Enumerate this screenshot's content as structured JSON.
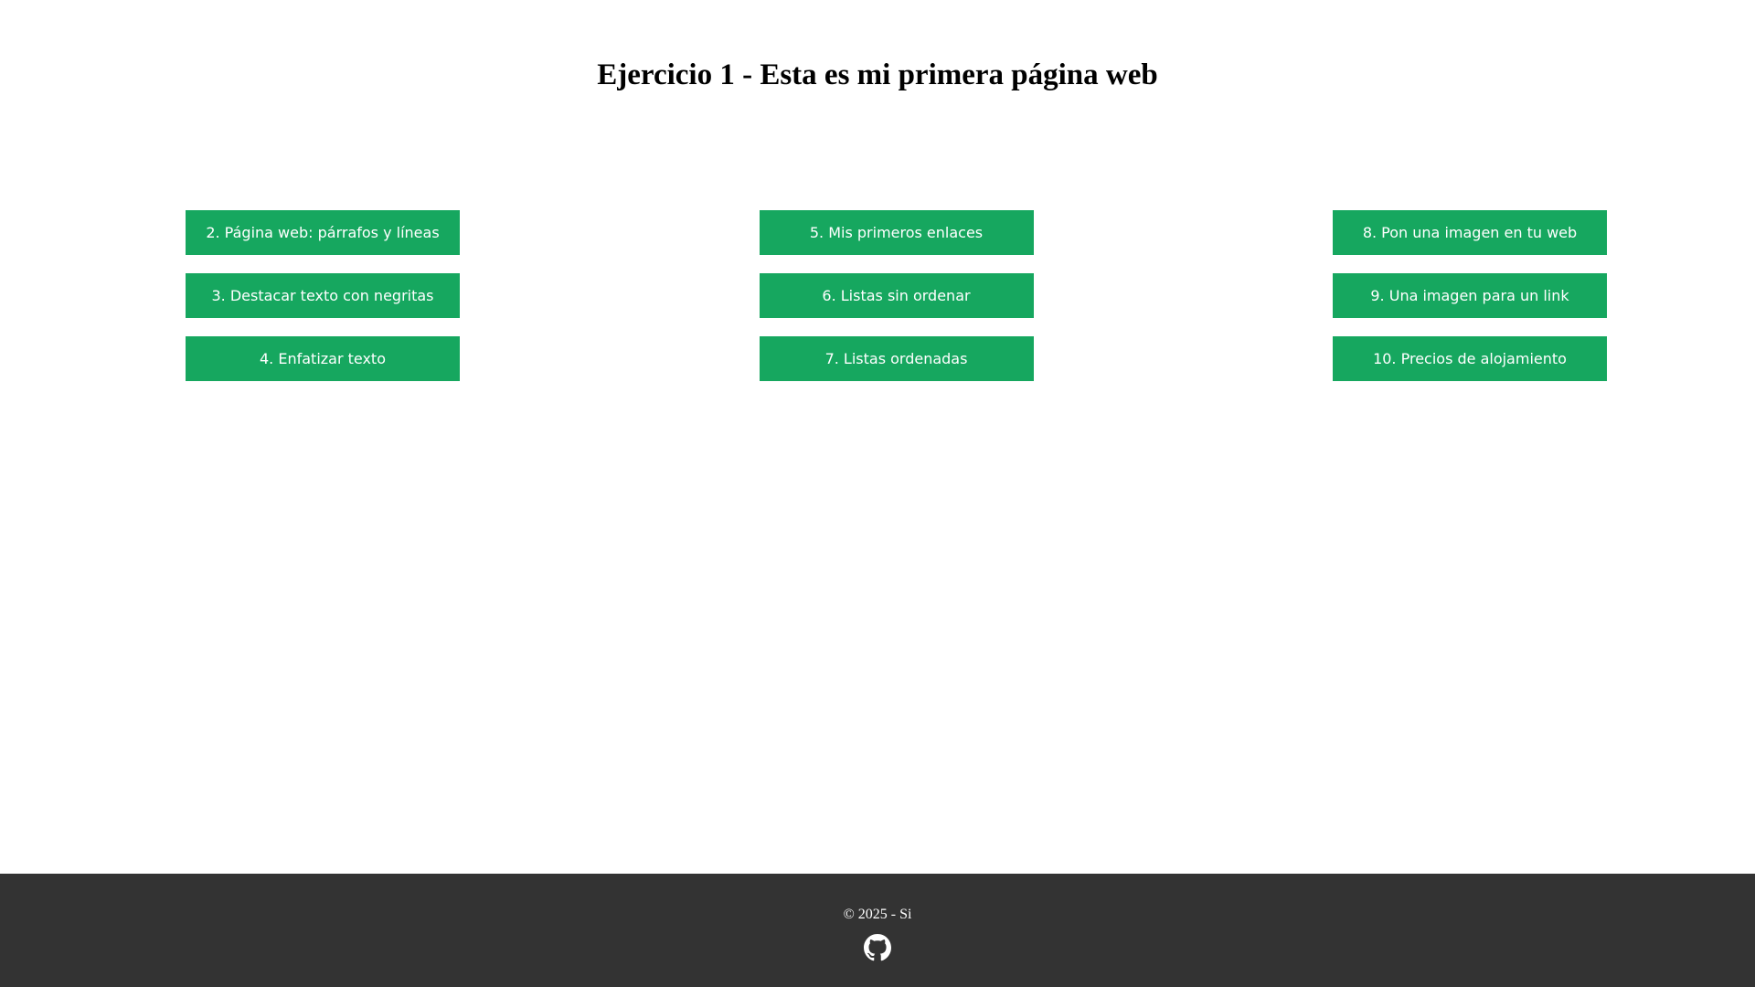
{
  "header": {
    "title": "Ejercicio 1 - Esta es mi primera página web"
  },
  "columns": [
    {
      "buttons": [
        {
          "label": "2. Página web: párrafos y líneas"
        },
        {
          "label": "3. Destacar texto con negritas"
        },
        {
          "label": "4. Enfatizar texto"
        }
      ]
    },
    {
      "buttons": [
        {
          "label": "5. Mis primeros enlaces"
        },
        {
          "label": "6. Listas sin ordenar"
        },
        {
          "label": "7. Listas ordenadas"
        }
      ]
    },
    {
      "buttons": [
        {
          "label": "8. Pon una imagen en tu web"
        },
        {
          "label": "9. Una imagen para un link"
        },
        {
          "label": "10. Precios de alojamiento"
        }
      ]
    }
  ],
  "footer": {
    "copyright": "© 2025 - Si",
    "icon": "github-icon"
  },
  "colors": {
    "button_bg": "#16a75f",
    "button_text": "#ffffff",
    "footer_bg": "#333333",
    "page_bg": "#ffffff"
  }
}
